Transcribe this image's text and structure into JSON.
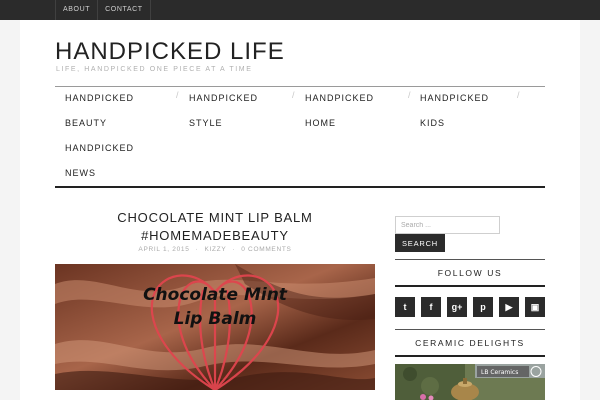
{
  "topbar": {
    "links": [
      {
        "label": "ABOUT"
      },
      {
        "label": "CONTACT"
      }
    ]
  },
  "header": {
    "site_title": "HANDPICKED LIFE",
    "tagline": "LIFE, HANDPICKED ONE PIECE AT A TIME"
  },
  "nav": {
    "items": [
      {
        "line1": "HANDPICKED",
        "line2": "BEAUTY"
      },
      {
        "line1": "HANDPICKED",
        "line2": "STYLE"
      },
      {
        "line1": "HANDPICKED",
        "line2": "HOME"
      },
      {
        "line1": "HANDPICKED",
        "line2": "KIDS"
      },
      {
        "line1": "HANDPICKED",
        "line2": "NEWS"
      }
    ],
    "separator": "/"
  },
  "post": {
    "title_line1": "CHOCOLATE MINT LIP BALM",
    "title_line2": "#HOMEMADEBEAUTY",
    "date": "APRIL 1, 2015",
    "author": "KIZZY",
    "comments": "0 COMMENTS",
    "meta_sep": "·",
    "image_text_line1": "Chocolate Mint",
    "image_text_line2": "Lip Balm"
  },
  "sidebar": {
    "search_placeholder": "Search ...",
    "search_button": "SEARCH",
    "follow_title": "FOLLOW US",
    "social": [
      {
        "icon": "twitter-icon",
        "glyph": "t"
      },
      {
        "icon": "facebook-icon",
        "glyph": "f"
      },
      {
        "icon": "google-plus-icon",
        "glyph": "g+"
      },
      {
        "icon": "pinterest-icon",
        "glyph": "p"
      },
      {
        "icon": "youtube-icon",
        "glyph": "▶"
      },
      {
        "icon": "instagram-icon",
        "glyph": "▣"
      }
    ],
    "ceramic_title": "CERAMIC DELIGHTS",
    "ceramic_image_label": "LB Ceramics"
  },
  "colors": {
    "dark": "#2b2b2b",
    "page_bg": "#f4f4f4",
    "card_bg": "#ffffff",
    "chocolate": "#5a2a1a",
    "whisk_red": "#e0454e"
  }
}
